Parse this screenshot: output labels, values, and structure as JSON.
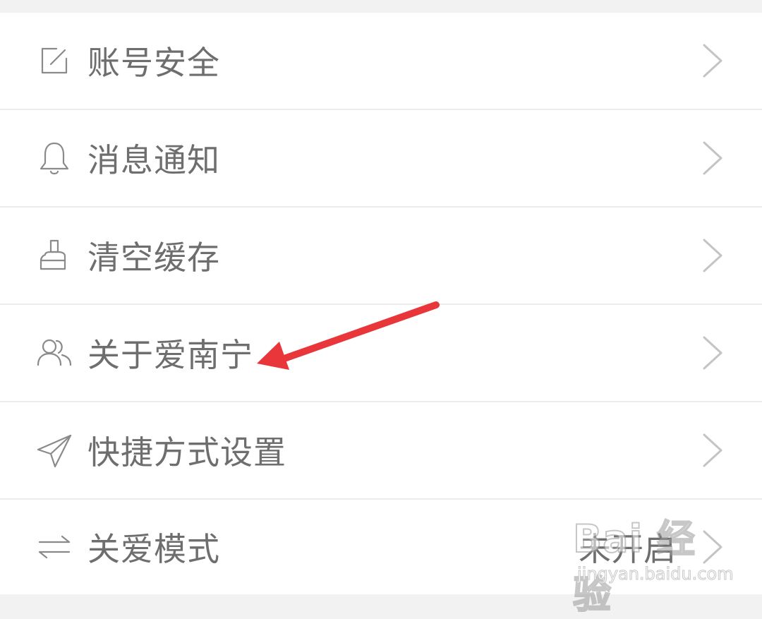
{
  "settings": {
    "items": [
      {
        "icon": "edit-icon",
        "label": "账号安全"
      },
      {
        "icon": "bell-icon",
        "label": "消息通知"
      },
      {
        "icon": "broom-icon",
        "label": "清空缓存"
      },
      {
        "icon": "users-icon",
        "label": "关于爱南宁"
      },
      {
        "icon": "send-icon",
        "label": "快捷方式设置"
      },
      {
        "icon": "switch-arrows-icon",
        "label": "关爱模式",
        "value": "未开启"
      }
    ]
  },
  "annotation": {
    "arrow_color": "#e8363b",
    "target": "关于爱南宁"
  },
  "watermark": {
    "brand": "Bai 经验",
    "url": "jingyan.baidu.com"
  }
}
